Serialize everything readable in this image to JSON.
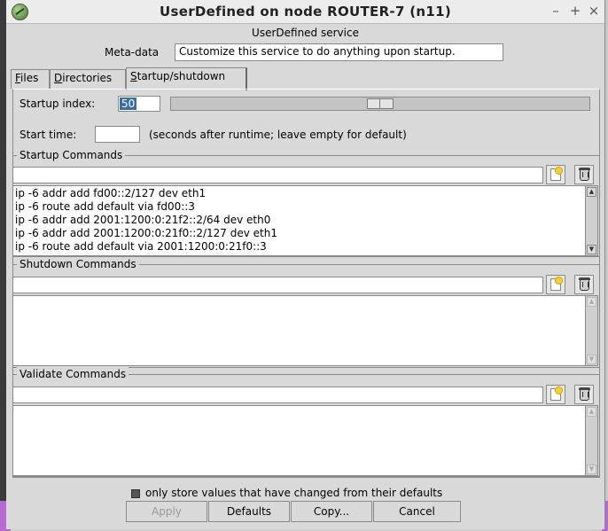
{
  "window": {
    "title": "UserDefined on node ROUTER-7 (n11)",
    "minimize": "–",
    "maximize": "+",
    "close": "×"
  },
  "service": {
    "name": "UserDefined service",
    "meta_label": "Meta-data",
    "meta_value": "Customize this service to do anything upon startup."
  },
  "tabs": [
    {
      "label": "Files",
      "underline": "F",
      "rest": "iles"
    },
    {
      "label": "Directories",
      "underline": "D",
      "rest": "irectories"
    },
    {
      "label": "Startup/shutdown",
      "underline": "S",
      "rest": "tartup/shutdown"
    }
  ],
  "startup": {
    "index_label": "Startup index:",
    "index_value": "50",
    "scale_value": 50,
    "time_label": "Start time:",
    "time_value": "",
    "time_hint": "(seconds after runtime; leave empty for default)"
  },
  "startup_commands": {
    "title": "Startup Commands",
    "entry": "",
    "lines": [
      "ip -6 addr add fd00::2/127 dev eth1",
      "ip -6 route add default via fd00::3",
      "ip -6 addr add 2001:1200:0:21f2::2/64 dev eth0",
      "ip -6 addr add 2001:1200:0:21f0::2/127 dev eth1",
      "ip -6 route add default via 2001:1200:0:21f0::3"
    ]
  },
  "shutdown_commands": {
    "title": "Shutdown Commands",
    "entry": ""
  },
  "validate_commands": {
    "title": "Validate Commands",
    "entry": ""
  },
  "footer": {
    "checkbox_label": "only store values that have changed from their defaults",
    "checkbox_checked": true,
    "apply": "Apply",
    "defaults": "Defaults",
    "copy": "Copy...",
    "cancel": "Cancel"
  },
  "icons": {
    "add": "new-document-icon",
    "delete": "trash-can-icon",
    "window": "node-config-icon"
  }
}
